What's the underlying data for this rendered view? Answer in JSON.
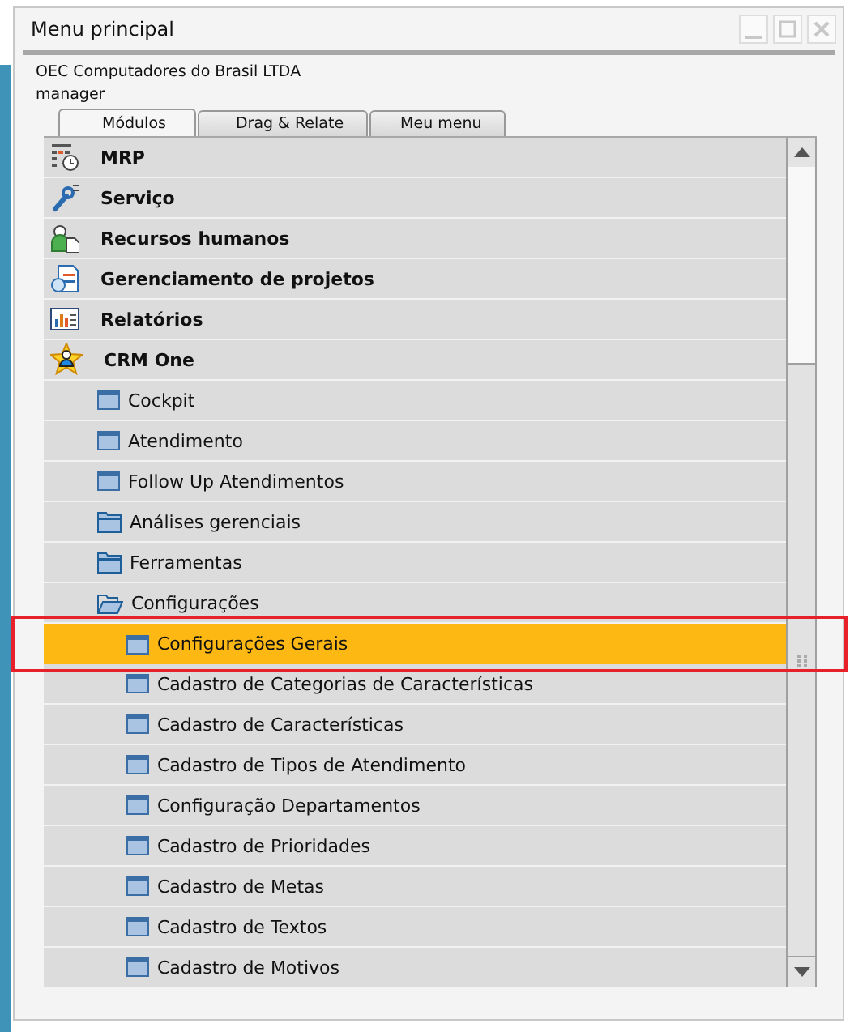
{
  "window": {
    "title": "Menu principal"
  },
  "company": "OEC Computadores do Brasil LTDA",
  "user": "manager",
  "tabs": [
    {
      "label": "Módulos",
      "selected": true
    },
    {
      "label": "Drag & Relate",
      "selected": false
    },
    {
      "label": "Meu menu",
      "selected": false
    }
  ],
  "modules": [
    {
      "label": "MRP",
      "kind": "mrp",
      "selected": false
    },
    {
      "label": "Serviço",
      "kind": "service",
      "selected": false
    },
    {
      "label": "Recursos humanos",
      "kind": "hr",
      "selected": false
    },
    {
      "label": "Gerenciamento de projetos",
      "kind": "project",
      "selected": false
    },
    {
      "label": "Relatórios",
      "kind": "report",
      "selected": false
    },
    {
      "label": "CRM One",
      "kind": "crm",
      "selected": false,
      "expanded": true,
      "children": [
        {
          "label": "Cockpit",
          "kind": "form",
          "selected": false
        },
        {
          "label": "Atendimento",
          "kind": "form",
          "selected": false
        },
        {
          "label": "Follow Up Atendimentos",
          "kind": "form",
          "selected": false
        },
        {
          "label": "Análises gerenciais",
          "kind": "folder",
          "selected": false,
          "expanded": false
        },
        {
          "label": "Ferramentas",
          "kind": "folder",
          "selected": false,
          "expanded": false
        },
        {
          "label": "Configurações",
          "kind": "folder",
          "selected": false,
          "expanded": true,
          "children": [
            {
              "label": "Configurações Gerais",
              "kind": "form",
              "selected": true,
              "framed": true
            },
            {
              "label": "Cadastro de Categorias de Características",
              "kind": "form",
              "selected": false
            },
            {
              "label": "Cadastro de Características",
              "kind": "form",
              "selected": false
            },
            {
              "label": "Cadastro de Tipos de Atendimento",
              "kind": "form",
              "selected": false
            },
            {
              "label": "Configuração Departamentos",
              "kind": "form",
              "selected": false
            },
            {
              "label": "Cadastro de Prioridades",
              "kind": "form",
              "selected": false
            },
            {
              "label": "Cadastro de Metas",
              "kind": "form",
              "selected": false
            },
            {
              "label": "Cadastro de Textos",
              "kind": "form",
              "selected": false
            },
            {
              "label": "Cadastro de Motivos",
              "kind": "form",
              "selected": false
            }
          ]
        }
      ]
    }
  ]
}
